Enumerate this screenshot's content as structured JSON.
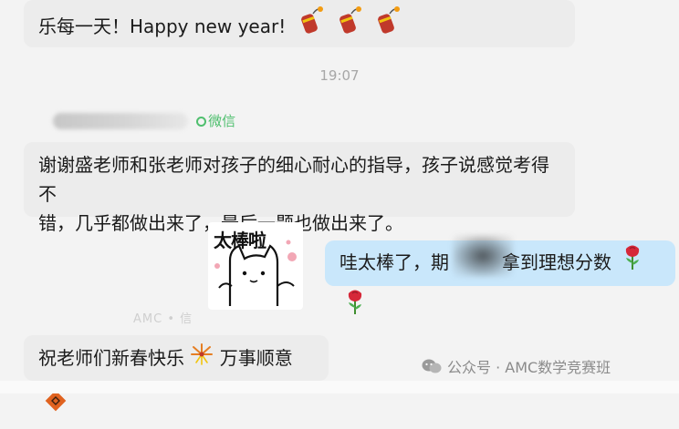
{
  "messages": {
    "top_greeting": "乐每一天！Happy new year!",
    "time": "19:07",
    "sender_tag": "微信",
    "thank_you_line1": "谢谢盛老师和张老师对孩子的细心耐心的指导，孩子说感觉考得不",
    "thank_you_line2": "错，几乎都做出来了，最后一题也做出来了。",
    "sticker_text": "太棒啦",
    "reply_part1": "哇太棒了，期",
    "reply_part2": "拿到理想分数",
    "faded_sender_tag": "AMC • 信",
    "new_year_part1": "祝老师们新春快乐",
    "new_year_part2": "万事顺意"
  },
  "watermark": {
    "text": "公众号 · AMC数学竞赛班"
  },
  "icons": {
    "firecracker": "firecracker-icon",
    "rose": "rose-icon",
    "firework": "firework-icon",
    "fortune": "fu-diamond-icon",
    "wechat": "wechat-logo-icon"
  },
  "colors": {
    "incoming_bubble": "#ececec",
    "outgoing_bubble": "#c9e7fb",
    "wechat_green": "#4fbf6e",
    "timestamp": "#a7a7a7"
  }
}
